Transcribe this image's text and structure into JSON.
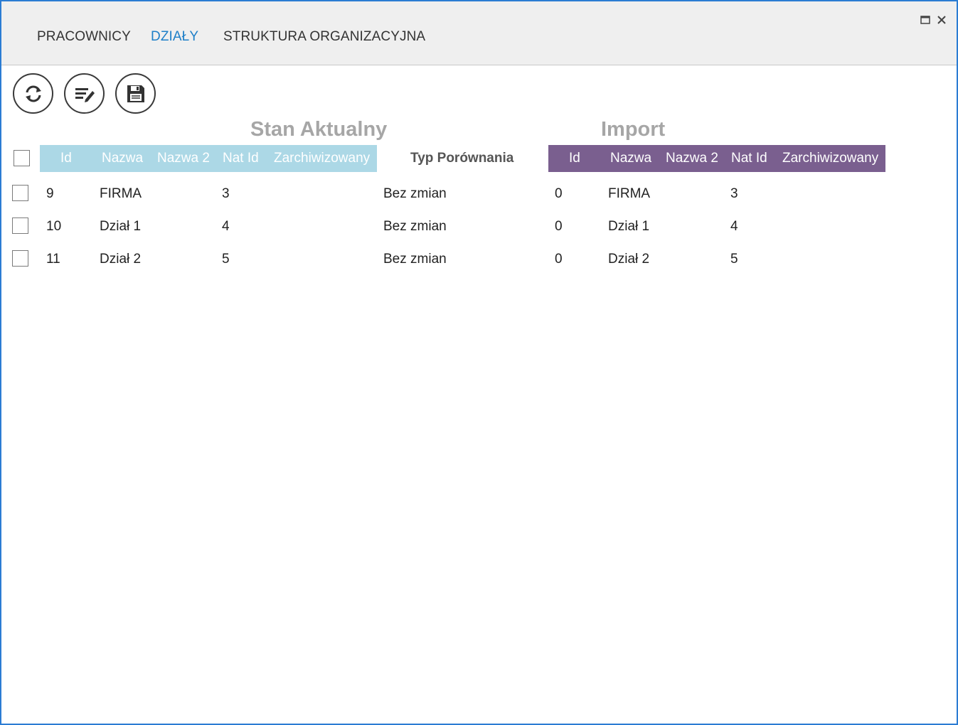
{
  "tabs": [
    {
      "label": "PRACOWNICY"
    },
    {
      "label": "DZIAŁY"
    },
    {
      "label": "STRUKTURA ORGANIZACYJNA"
    }
  ],
  "active_tab": "DZIAŁY",
  "window_controls": {
    "maximize_icon": "maximize-icon",
    "close_icon": "close-icon"
  },
  "toolbar": {
    "refresh_icon": "refresh-icon",
    "edit_icon": "edit-list-icon",
    "save_icon": "save-icon"
  },
  "current": {
    "title": "Stan Aktualny",
    "columns": [
      "Id",
      "Nazwa",
      "Nazwa 2",
      "Nat Id",
      "Zarchiwizowany"
    ]
  },
  "comparison_header": "Typ Porównania",
  "import": {
    "title": "Import",
    "columns": [
      "Id",
      "Nazwa",
      "Nazwa 2",
      "Nat Id",
      "Zarchiwizowany"
    ]
  },
  "colors": {
    "current_header_bg": "#acd8e6",
    "import_header_bg": "#7a5f8f",
    "active_tab": "#1e7fc8",
    "window_border": "#2b7cd3"
  },
  "rows": [
    {
      "current": {
        "id": "9",
        "nazwa": "FIRMA",
        "nazwa2": "",
        "nat_id": "3",
        "zarchiwizowany": ""
      },
      "typ": "Bez zmian",
      "import": {
        "id": "0",
        "nazwa": "FIRMA",
        "nazwa2": "",
        "nat_id": "3",
        "zarchiwizowany": ""
      }
    },
    {
      "current": {
        "id": "10",
        "nazwa": "Dział 1",
        "nazwa2": "",
        "nat_id": "4",
        "zarchiwizowany": ""
      },
      "typ": "Bez zmian",
      "import": {
        "id": "0",
        "nazwa": "Dział 1",
        "nazwa2": "",
        "nat_id": "4",
        "zarchiwizowany": ""
      }
    },
    {
      "current": {
        "id": "11",
        "nazwa": "Dział 2",
        "nazwa2": "",
        "nat_id": "5",
        "zarchiwizowany": ""
      },
      "typ": "Bez zmian",
      "import": {
        "id": "0",
        "nazwa": "Dział 2",
        "nazwa2": "",
        "nat_id": "5",
        "zarchiwizowany": ""
      }
    }
  ]
}
